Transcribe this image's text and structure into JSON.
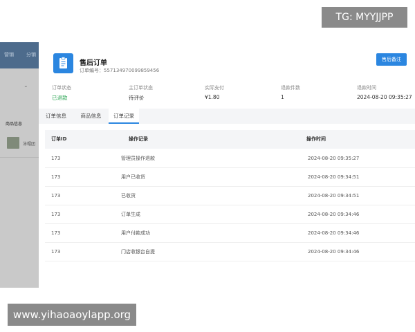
{
  "background": {
    "nav_items": [
      "营销",
      "分销"
    ],
    "goods_label": "商品信息",
    "goods_title": "泳帽团"
  },
  "drawer": {
    "title": "售后订单",
    "order_no": "订单编号：557134970099859456",
    "remark_button": "售后备注",
    "info": [
      {
        "label": "订单状态",
        "value": "已退款",
        "color": "#2aa552"
      },
      {
        "label": "主订单状态",
        "value": "待评价"
      },
      {
        "label": "实际支付",
        "value": "¥1.80"
      },
      {
        "label": "退款件数",
        "value": "1"
      },
      {
        "label": "退款时间",
        "value": "2024-08-20 09:35:27"
      }
    ],
    "tabs": [
      {
        "label": "订单信息",
        "active": false
      },
      {
        "label": "商品信息",
        "active": false
      },
      {
        "label": "订单记录",
        "active": true
      }
    ],
    "table": {
      "headers": [
        "订单ID",
        "操作记录",
        "操作时间"
      ],
      "rows": [
        [
          "173",
          "管理员操作退款",
          "2024-08-20 09:35:27"
        ],
        [
          "173",
          "用户已收货",
          "2024-08-20 09:34:51"
        ],
        [
          "173",
          "已收货",
          "2024-08-20 09:34:51"
        ],
        [
          "173",
          "订单生成",
          "2024-08-20 09:34:46"
        ],
        [
          "173",
          "用户付款成功",
          "2024-08-20 09:34:46"
        ],
        [
          "173",
          "门店收银台自提",
          "2024-08-20 09:34:46"
        ]
      ]
    },
    "accent_color": "#2b86e0"
  },
  "watermarks": {
    "tg": "TG: MYYJJPP",
    "site": "www.yihaoaoylapp.org"
  }
}
